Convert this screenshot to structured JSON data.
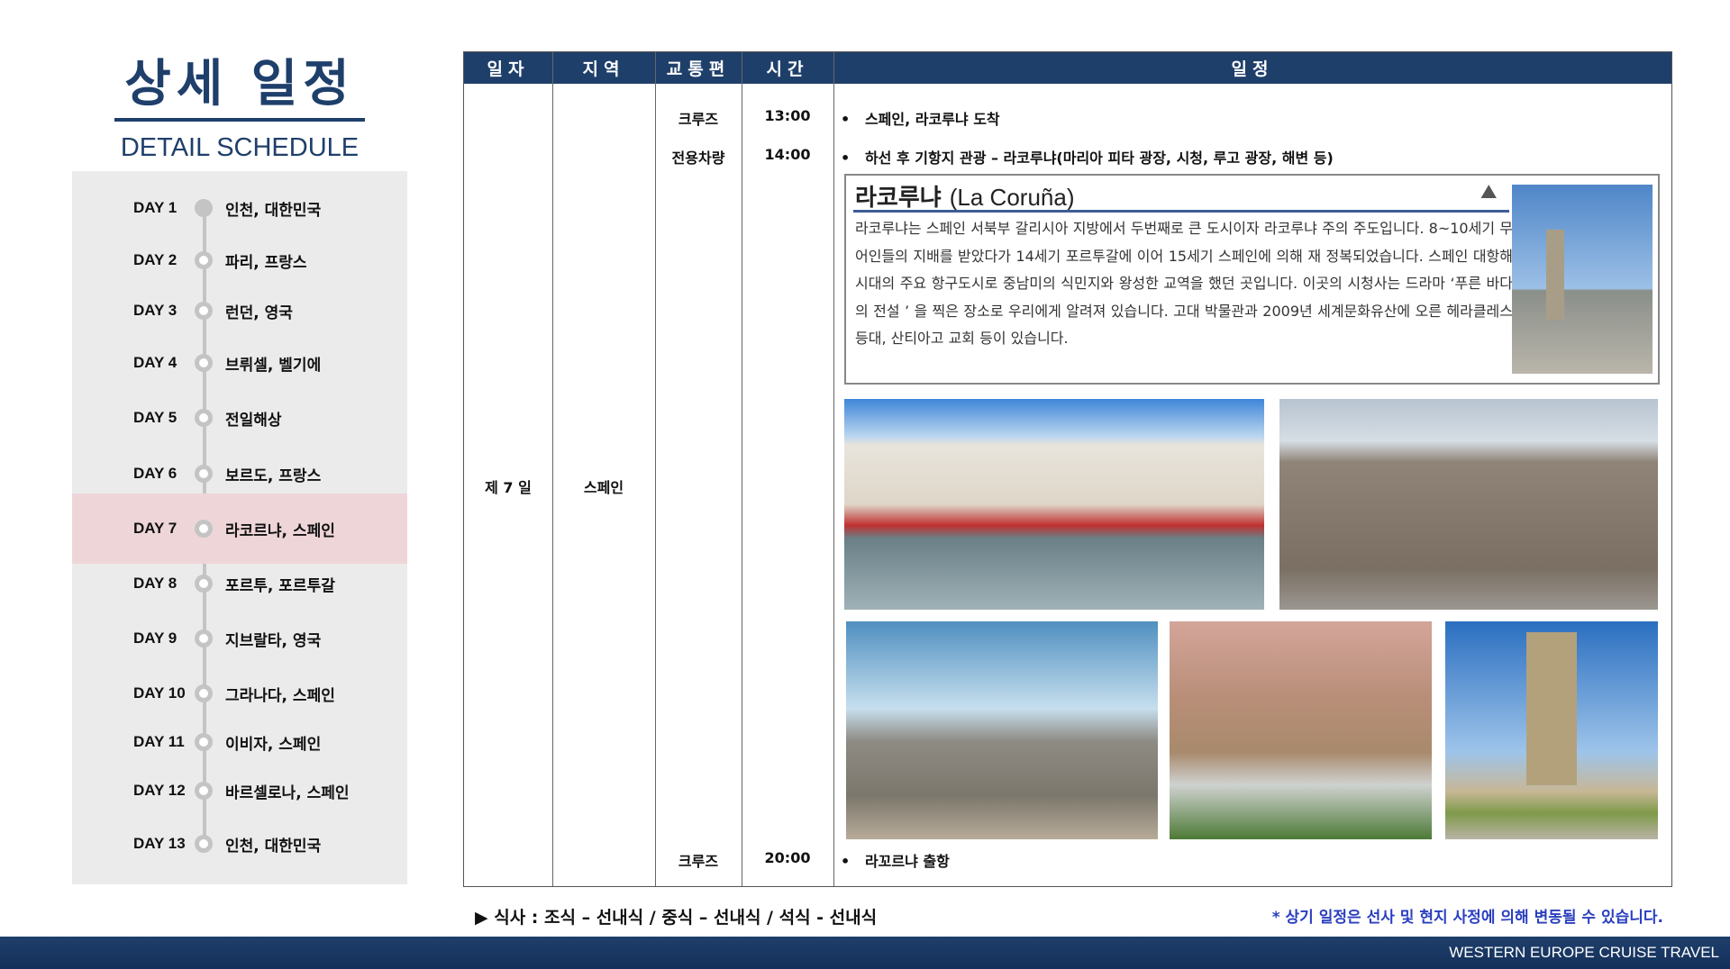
{
  "header": {
    "title": "상세 일정",
    "subtitle": "DETAIL SCHEDULE"
  },
  "sidebar": {
    "days": [
      {
        "day": "DAY 1",
        "city": "인천, 대한민국"
      },
      {
        "day": "DAY 2",
        "city": "파리, 프랑스"
      },
      {
        "day": "DAY 3",
        "city": "런던, 영국"
      },
      {
        "day": "DAY 4",
        "city": "브뤼셀, 벨기에"
      },
      {
        "day": "DAY 5",
        "city": "전일해상"
      },
      {
        "day": "DAY 6",
        "city": "보르도, 프랑스"
      },
      {
        "day": "DAY 7",
        "city": "라코르냐, 스페인"
      },
      {
        "day": "DAY 8",
        "city": "포르투, 포르투갈"
      },
      {
        "day": "DAY 9",
        "city": "지브랄타, 영국"
      },
      {
        "day": "DAY 10",
        "city": "그라나다, 스페인"
      },
      {
        "day": "DAY 11",
        "city": "이비자, 스페인"
      },
      {
        "day": "DAY 12",
        "city": "바르셀로나, 스페인"
      },
      {
        "day": "DAY 13",
        "city": "인천, 대한민국"
      }
    ],
    "active": "DAY 7"
  },
  "table": {
    "headers": [
      "일자",
      "지역",
      "교통편",
      "시간",
      "일정"
    ],
    "day": "제 7 일",
    "region": "스페인",
    "rows": [
      {
        "transport": "크루즈",
        "time": "13:00",
        "plan": "스페인, 라코루냐 도착"
      },
      {
        "transport": "전용차량",
        "time": "14:00",
        "plan": "하선 후 기항지 관광 – 라코루냐(마리아 피타 광장, 시청, 루고 광장, 해변 등)"
      },
      {
        "transport": "크루즈",
        "time": "20:00",
        "plan": "라꼬르냐 출항"
      }
    ]
  },
  "info": {
    "title_ko": "라코루냐",
    "title_en": "(La Coruña)",
    "text": "라코루냐는 스페인 서북부 갈리시아 지방에서 두번째로 큰 도시이자 라코루냐 주의 주도입니다. 8~10세기 무어인들의 지배를 받았다가 14세기 포르투갈에 이어 15세기 스페인에 의해 재 정복되었습니다. 스페인 대항해 시대의 주요 항구도시로 중남미의 식민지와 왕성한 교역을 했던 곳입니다. 이곳의 시청사는 드라마 ‘푸른 바다의 전설 ’ 을 찍은 장소로 우리에게 알려져 있습니다. 고대 박물관과 2009년 세계문화유산에 오른 헤라클레스 등대, 산티아고 교회 등이 있습니다."
  },
  "footer": {
    "meals": "▶ 식사 : 조식 – 선내식 / 중식 – 선내식 / 석식 - 선내식",
    "note": "* 상기 일정은 선사 및 현지 사정에 의해 변동될 수 있습니다.",
    "brand": "WESTERN EUROPE CRUISE TRAVEL"
  },
  "colors": {
    "navy": "#1f3f6b",
    "highlight": "#eed6d8",
    "note": "#2a3fbf"
  }
}
